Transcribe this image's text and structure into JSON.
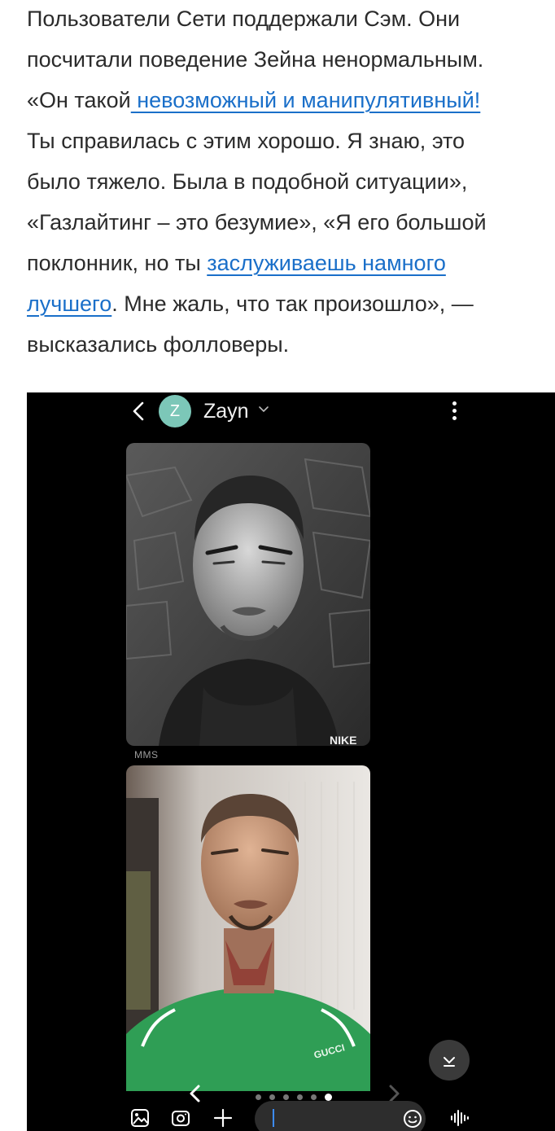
{
  "article": {
    "line1": "Пользователи Сети поддержали Сэм. Они",
    "line2": "посчитали поведение Зейна ненормальным.",
    "line3_pre": "«Он такой",
    "line3_link": " невозможный и манипулятивный!",
    "line4": "Ты справилась с этим хорошо. Я знаю, это",
    "line5": "было тяжело. Была в подобной ситуации»,",
    "line6": "«Газлайтинг – это безумие», «Я его большой",
    "line7_pre": "поклонник, но ты ",
    "line7_link": "заслуживаешь намного",
    "line8_link": "лучшего",
    "line8_post": ". Мне жаль, что так произошло», —",
    "line9": "высказались фолловеры."
  },
  "chat": {
    "avatar_letter": "Z",
    "contact_name": "Zayn",
    "msg1_label": "MMS",
    "photo1_brand": "NIKE",
    "photo2_brand": "GUCCI",
    "pager_count": 6,
    "pager_active": 5,
    "input_placeholder": ""
  },
  "icons": {
    "back": "chevron-left-icon",
    "name_dropdown": "chevron-down-icon",
    "menu": "more-vertical-icon",
    "scroll_down": "chevron-down-icon",
    "gallery": "gallery-icon",
    "camera": "camera-icon",
    "attach": "plus-icon",
    "emoji": "emoji-icon",
    "voice": "voice-wave-icon"
  },
  "colors": {
    "link": "#1a6fc9",
    "avatar": "#7cc7b8",
    "caret": "#3c8cff"
  }
}
